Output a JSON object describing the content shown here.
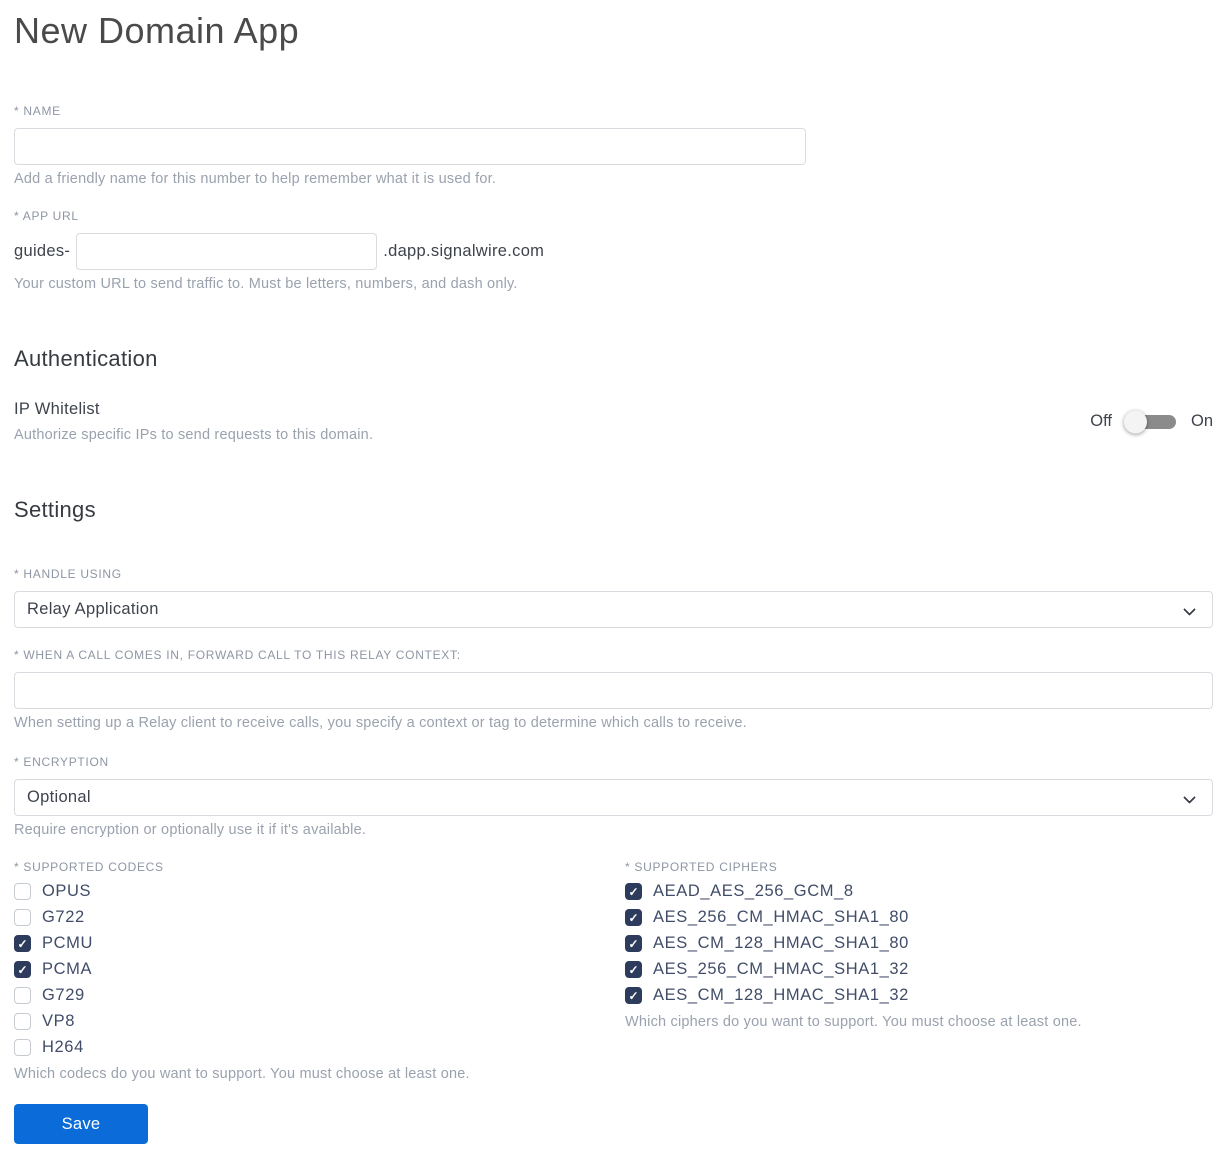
{
  "page": {
    "title": "New Domain App"
  },
  "colors": {
    "accent_blue": "#0b6bd9",
    "checkbox_checked": "#2d3b5c",
    "label_gray": "#8e96a3",
    "help_gray": "#9aa2ae",
    "input_border": "#d8dbe0",
    "toggle_track": "#8b8b8b"
  },
  "name_field": {
    "label": "* NAME",
    "value": "",
    "help": "Add a friendly name for this number to help remember what it is used for."
  },
  "app_url": {
    "label": "* APP URL",
    "prefix": "guides-",
    "value": "",
    "suffix": ".dapp.signalwire.com",
    "help": "Your custom URL to send traffic to. Must be letters, numbers, and dash only."
  },
  "authentication": {
    "heading": "Authentication",
    "ip_whitelist": {
      "label": "IP Whitelist",
      "help": "Authorize specific IPs to send requests to this domain.",
      "off_label": "Off",
      "on_label": "On",
      "state": "off"
    }
  },
  "settings": {
    "heading": "Settings",
    "handle_using": {
      "label": "* HANDLE USING",
      "value": "Relay Application"
    },
    "relay_context": {
      "label": "* WHEN A CALL COMES IN, FORWARD CALL TO THIS RELAY CONTEXT:",
      "value": "",
      "help": "When setting up a Relay client to receive calls, you specify a context or tag to determine which calls to receive."
    },
    "encryption": {
      "label": "* ENCRYPTION",
      "value": "Optional",
      "help": "Require encryption or optionally use it if it's available."
    },
    "codecs": {
      "label": "* SUPPORTED CODECS",
      "help": "Which codecs do you want to support. You must choose at least one.",
      "options": [
        {
          "label": "OPUS",
          "checked": false
        },
        {
          "label": "G722",
          "checked": false
        },
        {
          "label": "PCMU",
          "checked": true
        },
        {
          "label": "PCMA",
          "checked": true
        },
        {
          "label": "G729",
          "checked": false
        },
        {
          "label": "VP8",
          "checked": false
        },
        {
          "label": "H264",
          "checked": false
        }
      ]
    },
    "ciphers": {
      "label": "* SUPPORTED CIPHERS",
      "help": "Which ciphers do you want to support. You must choose at least one.",
      "options": [
        {
          "label": "AEAD_AES_256_GCM_8",
          "checked": true
        },
        {
          "label": "AES_256_CM_HMAC_SHA1_80",
          "checked": true
        },
        {
          "label": "AES_CM_128_HMAC_SHA1_80",
          "checked": true
        },
        {
          "label": "AES_256_CM_HMAC_SHA1_32",
          "checked": true
        },
        {
          "label": "AES_CM_128_HMAC_SHA1_32",
          "checked": true
        }
      ]
    }
  },
  "save_button": {
    "label": "Save"
  }
}
